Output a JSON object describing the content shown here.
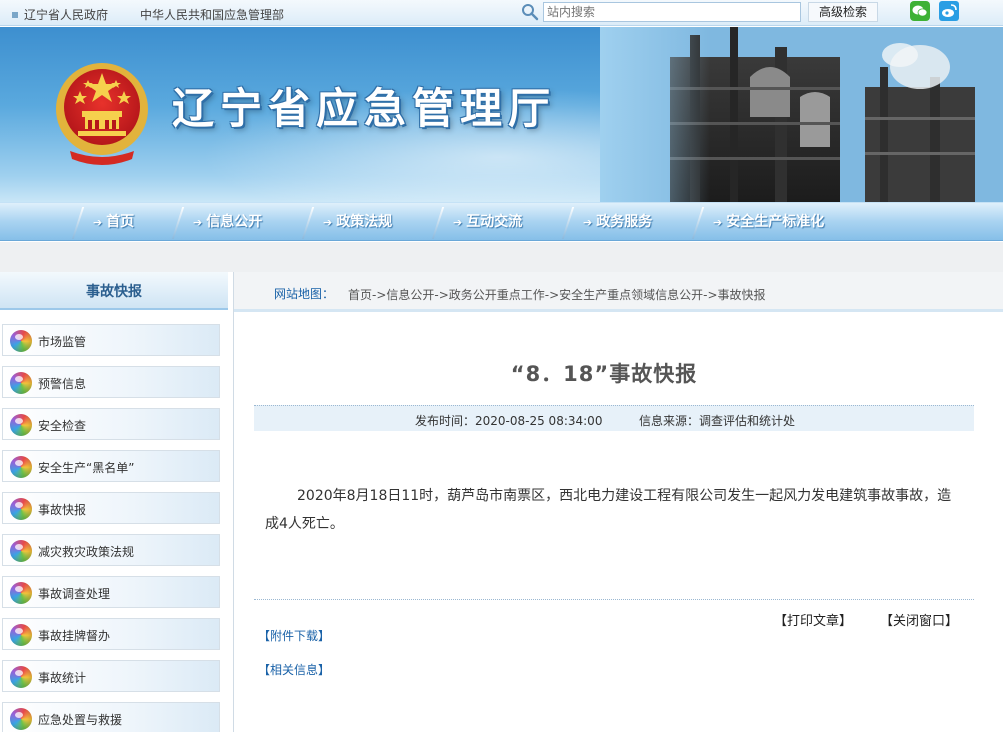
{
  "topbar": {
    "link_liaoning_gov": "辽宁省人民政府",
    "link_mem": "中华人民共和国应急管理部",
    "search_placeholder": "站内搜索",
    "advanced_search_label": "高级检索",
    "icons": [
      "search-icon",
      "wechat-icon",
      "weibo-icon"
    ]
  },
  "banner": {
    "site_title": "辽宁省应急管理厅",
    "emblem_icon": "national-emblem-icon"
  },
  "nav": {
    "items": [
      "首页",
      "信息公开",
      "政策法规",
      "互动交流",
      "政务服务",
      "安全生产标准化"
    ]
  },
  "sidebar": {
    "title": "事故快报",
    "items": [
      "市场监管",
      "预警信息",
      "安全检查",
      "安全生产“黑名单”",
      "事故快报",
      "减灾救灾政策法规",
      "事故调查处理",
      "事故挂牌督办",
      "事故统计",
      "应急处置与救援"
    ]
  },
  "breadcrumb": {
    "label": "网站地图：",
    "path": "首页->信息公开->政务公开重点工作->安全生产重点领域信息公开->事故快报"
  },
  "article": {
    "title": "“8．18”事故快报",
    "publish_time": "发布时间：2020-08-25 08:34:00",
    "source": "信息来源：调查评估和统计处",
    "body": "2020年8月18日11时，葫芦岛市南票区，西北电力建设工程有限公司发生一起风力发电建筑事故事故，造成4人死亡。",
    "print_label": "【打印文章】",
    "close_label": "【关闭窗口】",
    "attachments_label": "【附件下载】",
    "related_label": "【相关信息】"
  },
  "colors": {
    "nav_blue": "#86bfe8",
    "link_blue": "#1a62a8",
    "banner_blue": "#3d8fcf"
  }
}
